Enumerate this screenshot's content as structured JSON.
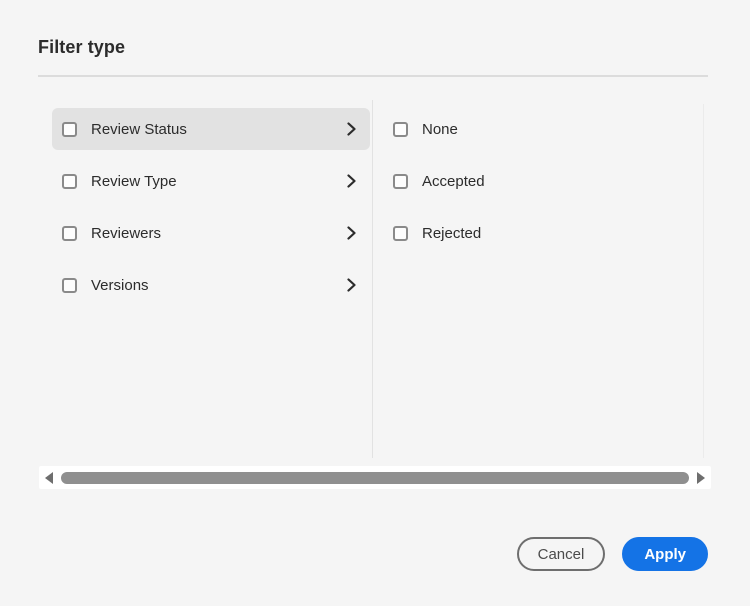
{
  "dialog": {
    "title": "Filter type"
  },
  "panels": {
    "left": {
      "items": [
        {
          "label": "Review Status",
          "checked": false,
          "selected": true,
          "has_submenu": true
        },
        {
          "label": "Review Type",
          "checked": false,
          "selected": false,
          "has_submenu": true
        },
        {
          "label": "Reviewers",
          "checked": false,
          "selected": false,
          "has_submenu": true
        },
        {
          "label": "Versions",
          "checked": false,
          "selected": false,
          "has_submenu": true
        }
      ]
    },
    "right": {
      "items": [
        {
          "label": "None",
          "checked": false
        },
        {
          "label": "Accepted",
          "checked": false
        },
        {
          "label": "Rejected",
          "checked": false
        }
      ]
    }
  },
  "scrollbar": {
    "orientation": "horizontal",
    "icons": {
      "left": "left-triangle",
      "right": "right-triangle"
    }
  },
  "footer": {
    "cancel_label": "Cancel",
    "apply_label": "Apply"
  },
  "colors": {
    "background": "#f5f5f5",
    "selected_row": "#e2e2e2",
    "text": "#2c2c2c",
    "checkbox_border": "#8a8a8a",
    "divider": "#dcdcdc",
    "scrollbar_thumb": "#8f8f8f",
    "scrollbar_track": "#ffffff",
    "accent_blue": "#1473e6",
    "cancel_border": "#6e6e6e"
  }
}
